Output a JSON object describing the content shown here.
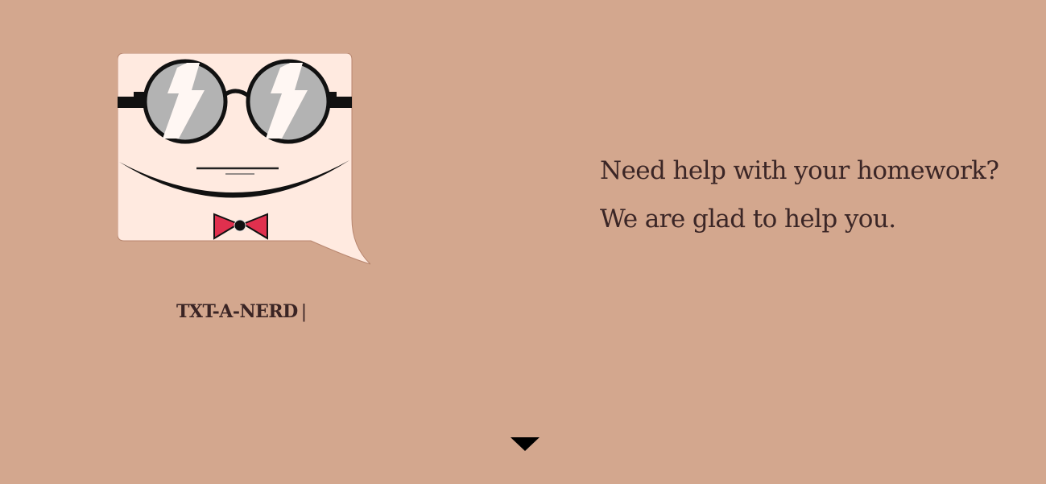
{
  "brand": {
    "name": "TXT-A-NERD",
    "cursor": "|"
  },
  "hero": {
    "line1": "Need help with your homework?",
    "line2": "We are glad to help you."
  },
  "icons": {
    "logo": "nerd-face-speech-bubble",
    "scroll": "caret-down-icon"
  },
  "colors": {
    "background": "#d3a78e",
    "bubble": "#ffeae0",
    "text": "#3b2626",
    "bowtie": "#e0304e"
  }
}
